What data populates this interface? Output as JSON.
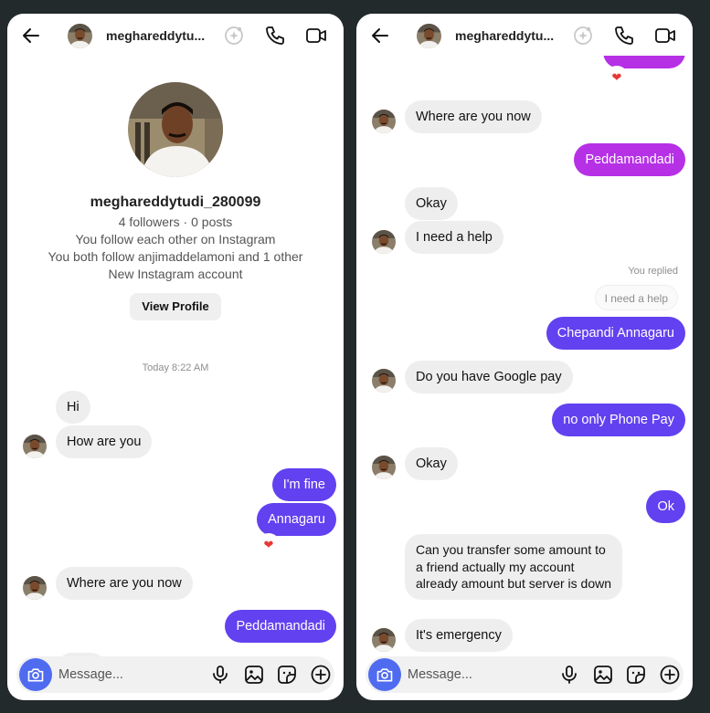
{
  "colors": {
    "outgoing_blue": "#6241f0",
    "outgoing_pink": "#b630e6",
    "incoming": "#eeeeef",
    "camera_button": "#4f6bf0",
    "backdrop": "#222a2c"
  },
  "left": {
    "header": {
      "name": "meghareddytu..."
    },
    "profile": {
      "username": "meghareddytudi_280099",
      "stats": "4 followers · 0 posts",
      "line1": "You follow each other on Instagram",
      "line2": "You both follow anjimaddelamoni and 1 other",
      "line3": "New Instagram account",
      "view_profile": "View Profile"
    },
    "timestamp": "Today 8:22 AM",
    "messages": {
      "m1": "Hi",
      "m2": "How are you",
      "m3": "I'm fine",
      "m4": "Annagaru",
      "m5": "Where are you now",
      "m6": "Peddamandadi"
    },
    "composer": {
      "placeholder": "Message..."
    }
  },
  "right": {
    "header": {
      "name": "meghareddytu..."
    },
    "messages": {
      "m1": "Where are you now",
      "m2": "Peddamandadi",
      "m3": "Okay",
      "m4": "I need a help",
      "replied_label": "You replied",
      "replied_quote": "I need a help",
      "m5": "Chepandi Annagaru",
      "m6": "Do you have Google pay",
      "m7": "no only Phone Pay",
      "m8": "Okay",
      "m9": "Ok",
      "m10": "Can you transfer some amount to a friend actually my account already amount but server is down",
      "m11": "It's emergency"
    },
    "composer": {
      "placeholder": "Message..."
    }
  },
  "icons": {
    "back": "back-arrow-icon",
    "effects": "sparkle-icon",
    "call": "phone-icon",
    "video": "video-camera-icon",
    "camera": "camera-icon",
    "mic": "microphone-icon",
    "gallery": "image-icon",
    "sticker": "sticker-icon",
    "add": "plus-circle-icon",
    "reaction": "heart-icon"
  }
}
